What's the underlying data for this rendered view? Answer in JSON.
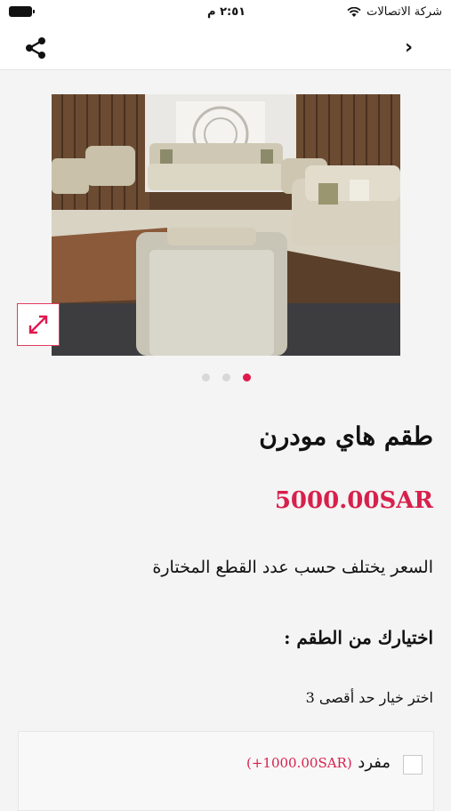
{
  "status": {
    "carrier": "شركة الاتصالات",
    "time": "٢:٥١ م"
  },
  "nav": {
    "share_icon": "share-icon",
    "back_icon": "chevron-icon"
  },
  "gallery": {
    "active_index": 2,
    "count": 3
  },
  "product": {
    "title": "طقم هاي مودرن",
    "price": "5000.00SAR",
    "price_note": "السعر يختلف حسب عدد القطع المختارة"
  },
  "options_section": {
    "heading": "اختيارك من الطقم  :",
    "hint": "اختر خيار حد أقصى 3",
    "items": [
      {
        "label": "مفرد",
        "price": "(+1000.00SAR)"
      }
    ]
  },
  "colors": {
    "accent": "#e0184e",
    "price": "#d8204c"
  }
}
